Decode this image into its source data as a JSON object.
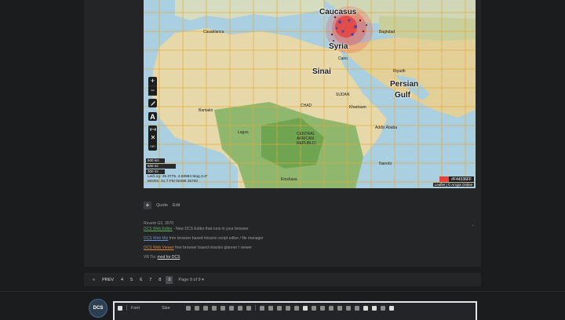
{
  "map": {
    "labels": {
      "caucasus": "Caucasus",
      "syria": "Syria",
      "sinai": "Sinai",
      "persian_gulf_1": "Persian",
      "persian_gulf_2": "Gulf",
      "casablanca": "Casablanca",
      "bamako": "Bamako",
      "lagos": "Lagos",
      "kinshasa": "Kinshasa",
      "khartoum": "Khartoum",
      "addis_ababa": "Addis Ababa",
      "nairobi": "Nairobi",
      "riyadh": "Riyadh",
      "baghdad": "Baghdad",
      "cairo": "Cairo",
      "central_african_republic": "CENTRAL AFRICAN REPUBLIC",
      "sudan": "SUDAN",
      "chad": "CHAD"
    },
    "scale": [
      "500 km",
      "500 mi",
      "300 mi"
    ],
    "coords_line1": "Lat/Lng: 45.3775, 4.59984 Mag.3.2*",
    "coords_line2": "MGRS: 31 T FM 00495 35700",
    "color_value": "#F44336FF",
    "color_swatch": "#e84336",
    "attribution": "Leaflet | © Arcgis Online",
    "zoom_in": "+",
    "zoom_out": "−",
    "tool_text": "A",
    "tool_ruler_unit": "nm"
  },
  "actions": {
    "plus": "+",
    "quote": "Quote",
    "edit": "Edit"
  },
  "signature": {
    "line1": "Reverb G2, 3070",
    "line2_link": "DCS Web Editor",
    "line2_text": " - New DCS Editor that runs in your browser",
    "line3_link": "DCS Web Miz",
    "line3_text": " free browser based mission script editor / file manager",
    "line4_link": "DCS Web Viewer",
    "line4_text": " free browser based mission planner / viewer",
    "line5_text": "VR Tix:",
    "line5_link": "mod for DCS"
  },
  "pager": {
    "prev": "PREV",
    "pages": [
      "4",
      "5",
      "6",
      "7",
      "8"
    ],
    "current": "9",
    "info": "Page 9 of 9"
  },
  "avatar_text": "DCS",
  "editor": {
    "font_label": "Font",
    "size_label": "Size"
  }
}
